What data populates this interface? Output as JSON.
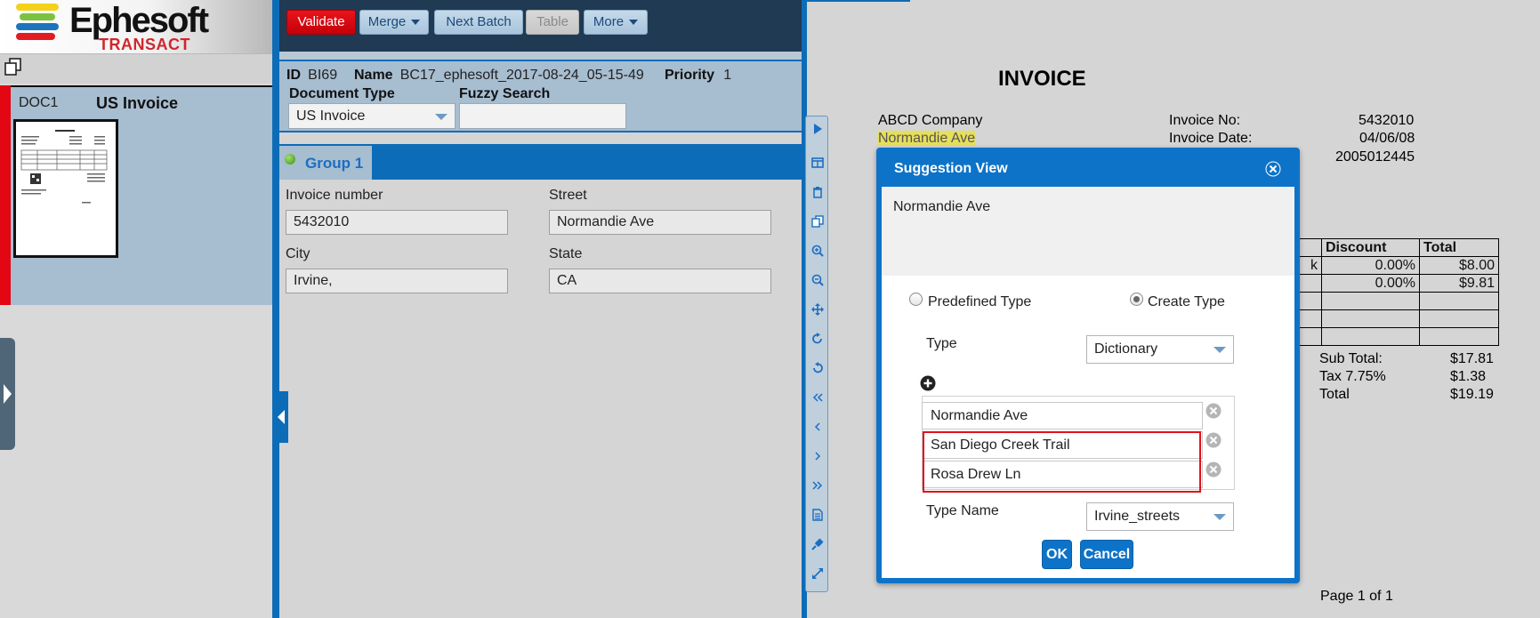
{
  "app": {
    "logo_name": "Ephesoft",
    "logo_product": "TRANSACT"
  },
  "left_panel": {
    "document": {
      "id": "DOC1",
      "type": "US Invoice"
    }
  },
  "toolbar": {
    "validate": "Validate",
    "merge": "Merge",
    "next_batch": "Next Batch",
    "table": "Table",
    "more": "More"
  },
  "batch": {
    "id_label": "ID",
    "id_value": "BI69",
    "name_label": "Name",
    "name_value": "BC17_ephesoft_2017-08-24_05-15-49",
    "priority_label": "Priority",
    "priority_value": "1",
    "doc_type_label": "Document Type",
    "doc_type_value": "US Invoice",
    "fuzzy_label": "Fuzzy Search",
    "fuzzy_value": ""
  },
  "group": {
    "label": "Group 1",
    "fields": [
      {
        "label": "Invoice number",
        "value": "5432010"
      },
      {
        "label": "Street",
        "value": "Normandie Ave"
      },
      {
        "label": "City",
        "value": "Irvine,"
      },
      {
        "label": "State",
        "value": "CA"
      }
    ]
  },
  "viewer_icons": [
    "play-icon",
    "split-view-icon",
    "trash-icon",
    "copy-icon",
    "zoom-in-icon",
    "zoom-out-icon",
    "move-icon",
    "rotate-right-icon",
    "rotate-left-icon",
    "first-page-icon",
    "prev-page-icon",
    "next-page-icon",
    "last-page-icon",
    "document-icon",
    "plugin-icon",
    "fullscreen-icon"
  ],
  "invoice": {
    "title": "INVOICE",
    "company": "ABCD Company",
    "street_highlight": "Normandie Ave",
    "invoice_no_label": "Invoice No:",
    "invoice_no": "5432010",
    "invoice_date_label": "Invoice Date:",
    "invoice_date": "04/06/08",
    "customer_no": "2005012445",
    "table_header": [
      "Discount",
      "Total"
    ],
    "rows": [
      {
        "discount": "0.00%",
        "total": "$8.00"
      },
      {
        "discount": "0.00%",
        "total": "$9.81"
      }
    ],
    "row_edge_char": "k",
    "subtotal_label": "Sub Total:",
    "subtotal": "$17.81",
    "tax_label": "Tax 7.75%",
    "tax": "$1.38",
    "total_label": "Total",
    "total": "$19.19",
    "page_count": "Page 1 of 1"
  },
  "suggestion_dialog": {
    "title": "Suggestion View",
    "suggested_text": "Normandie Ave",
    "radio_predefined": "Predefined Type",
    "radio_create": "Create Type",
    "selected_radio": "Create Type",
    "type_label": "Type",
    "type_value": "Dictionary",
    "values": [
      "Normandie Ave",
      "San Diego Creek Trail",
      "Rosa Drew Ln"
    ],
    "type_name_label": "Type Name",
    "type_name_value": "Irvine_streets",
    "ok": "OK",
    "cancel": "Cancel"
  },
  "colors": {
    "accent_blue": "#0d6cb8",
    "validate_red": "#e30613",
    "panel_blue": "#a7bdd0",
    "highlight_yellow": "#e6df5a"
  }
}
